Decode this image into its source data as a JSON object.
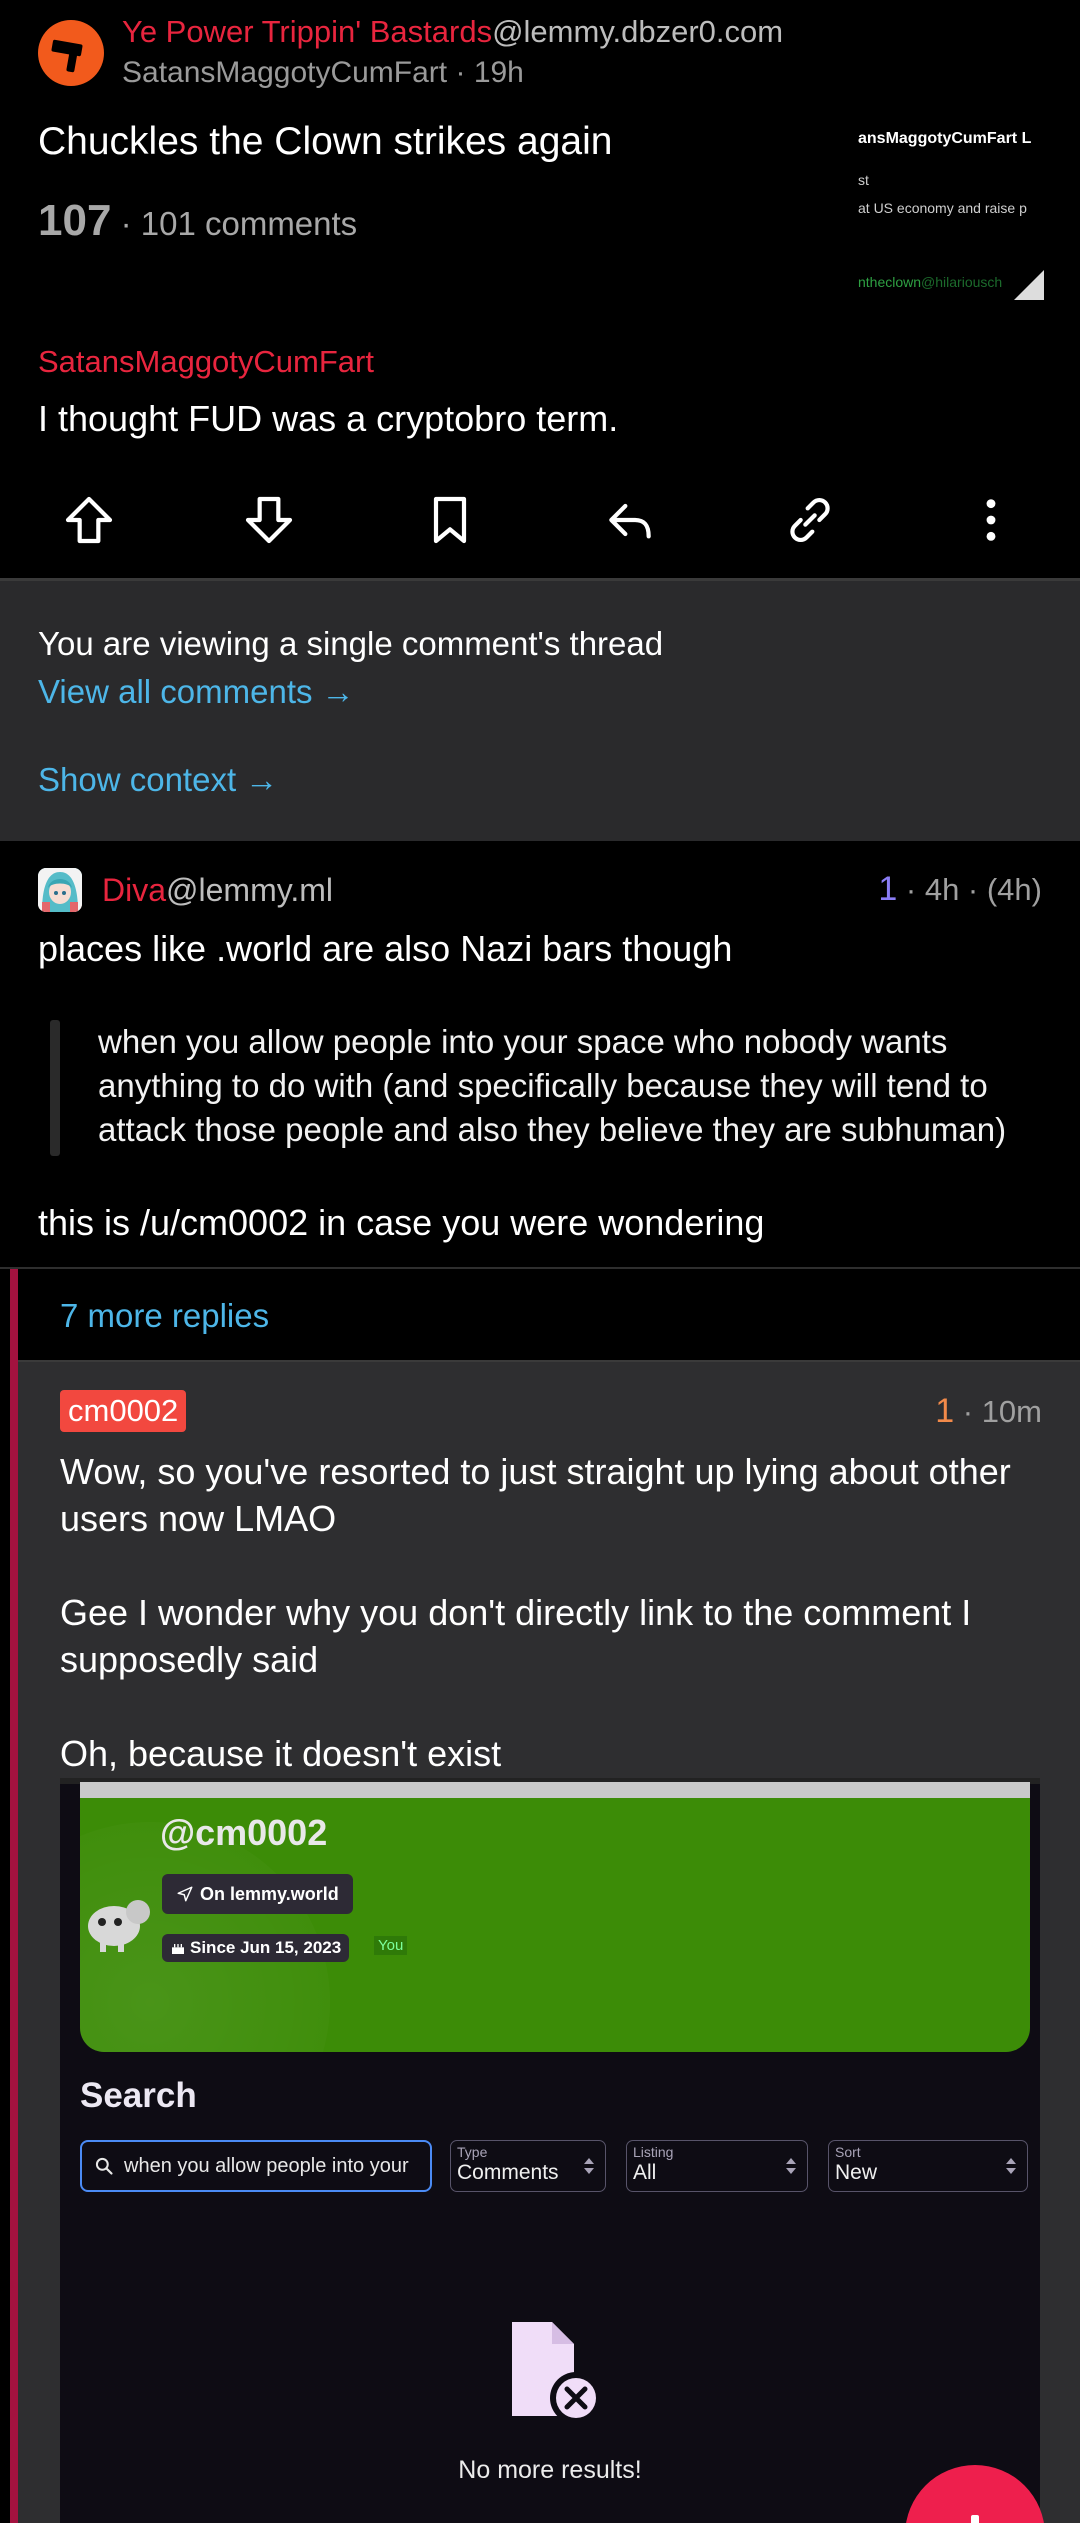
{
  "post": {
    "community_name": "Ye Power Trippin' Bastards",
    "community_instance": "@lemmy.dbzer0.com",
    "author": "SatansMaggotyCumFart",
    "age": "19h",
    "title": "Chuckles the Clown strikes again",
    "score": "107",
    "comments": "101 comments",
    "thumbnail": {
      "line1": "ansMaggotyCumFart L",
      "line2": "st",
      "line3": "at US economy and raise p",
      "line4a": "ntheclown",
      "line4b": "@hilariousch"
    }
  },
  "parent_comment": {
    "author": "SatansMaggotyCumFart",
    "body": "I thought FUD was a cryptobro term."
  },
  "actions": [
    "upvote-icon",
    "downvote-icon",
    "bookmark-icon",
    "reply-icon",
    "link-icon",
    "more-icon"
  ],
  "thread_notice": {
    "text": "You are viewing a single comment's thread",
    "view_all": "View all comments →",
    "show_context": "Show context →"
  },
  "diva_comment": {
    "name": "Diva",
    "instance": "@lemmy.ml",
    "score": "1",
    "age": " · 4h · (4h)",
    "p1": "places like .world are also Nazi bars though",
    "quote": "when you allow people into your space who nobody wants anything to do with (and specifically because they will tend to attack those people and also they believe they are subhuman)",
    "p2": "this is /u/cm0002 in case you were wondering"
  },
  "more_replies": "7 more replies",
  "reply": {
    "name": "cm0002",
    "score": "1",
    "age": " · 10m",
    "p1": "Wow, so you've resorted to just straight up lying about other users now LMAO",
    "p2": "Gee I wonder why you don't directly link to the comment I supposedly said",
    "p3": "Oh, because it doesn't exist"
  },
  "embed": {
    "handle": "@cm0002",
    "instance_chip": "On lemmy.world",
    "since_chip": "Since Jun 15, 2023",
    "you_tag": "You",
    "search_title": "Search",
    "search_value": "when you allow people into your",
    "type_label": "Type",
    "type_value": "Comments",
    "listing_label": "Listing",
    "listing_value": "All",
    "sort_label": "Sort",
    "sort_value": "New",
    "empty_text": "No more results!",
    "banner_color": "#3c8c07"
  },
  "colors": {
    "accent_red": "#e8253e",
    "link_blue": "#4db6e8",
    "score_purple": "#8a7df5",
    "score_orange": "#f28a4a",
    "thread_bar": "#a3123f",
    "fab": "#ee1f4d"
  }
}
